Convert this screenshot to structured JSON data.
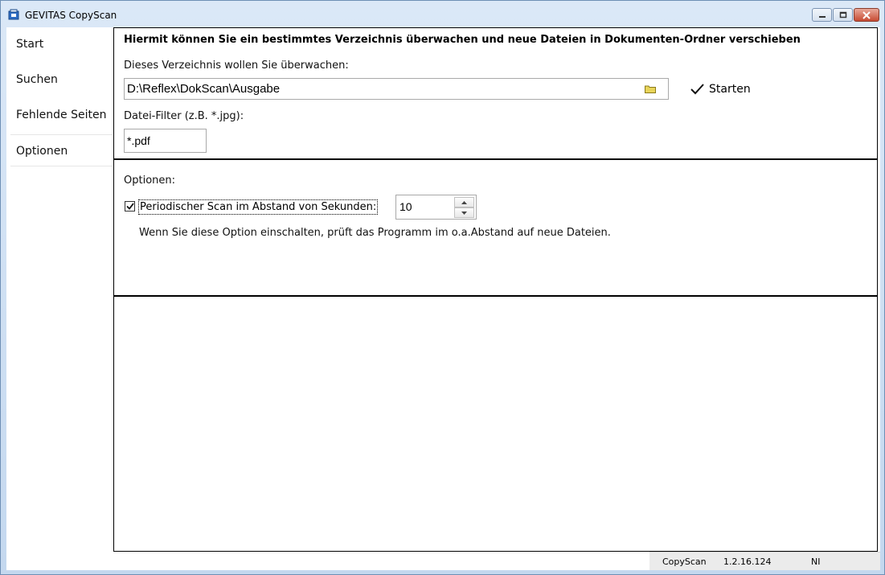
{
  "window": {
    "title": "GEVITAS CopyScan",
    "buttons": {
      "minimize": "minimize-icon",
      "maximize": "maximize-icon",
      "close": "close-icon"
    }
  },
  "sidebar": {
    "items": [
      {
        "label": "Start"
      },
      {
        "label": "Suchen"
      },
      {
        "label": "Fehlende Seiten"
      },
      {
        "label": "Optionen",
        "active": true
      }
    ]
  },
  "monitor": {
    "heading": "Hiermit können Sie ein bestimmtes Verzeichnis überwachen und neue Dateien in Dokumenten-Ordner verschieben",
    "dir_label": "Dieses Verzeichnis wollen Sie überwachen:",
    "dir_value": "D:\\Reflex\\DokScan\\Ausgabe",
    "start_label": "Starten",
    "filter_label": "Datei-Filter (z.B. *.jpg):",
    "filter_value": "*.pdf"
  },
  "options": {
    "title": "Optionen:",
    "periodic_label": "Periodischer Scan im Abstand von Sekunden:",
    "periodic_checked": true,
    "interval": "10",
    "hint": "Wenn Sie diese Option einschalten, prüft das Programm im o.a.Abstand auf neue Dateien."
  },
  "status": {
    "app": "CopyScan",
    "version": "1.2.16.124",
    "mode": "NI"
  },
  "colors": {
    "accent_frame": "#6e8fb5",
    "close_button": "#c74a32",
    "folder_icon": "#e8d45a"
  }
}
